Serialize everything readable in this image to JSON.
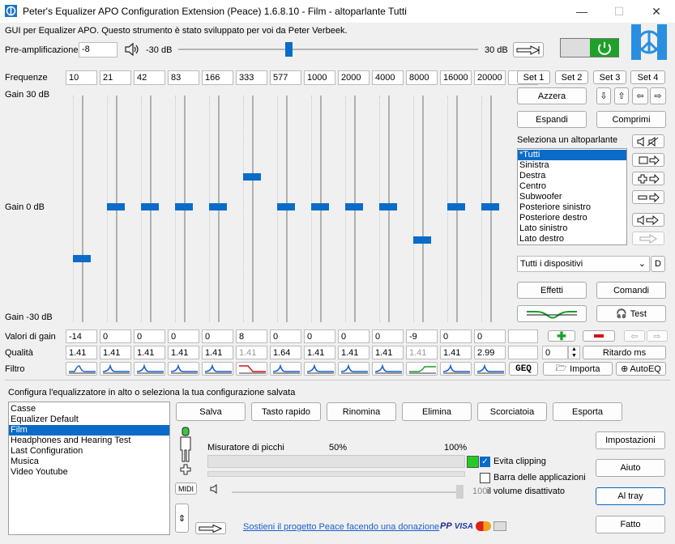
{
  "window": {
    "title": "Peter's Equalizer APO Configuration Extension (Peace) 1.6.8.10 - Film - altoparlante Tutti",
    "minimize": "—",
    "maximize": "☐",
    "close": "✕"
  },
  "header": {
    "description": "GUI per Equalizer APO. Questo strumento è stato sviluppato per voi da Peter Verbeek.",
    "preamp_label": "Pre-amplificazione",
    "preamp_value": "-8",
    "preamp_min": "-30 dB",
    "preamp_max": "30 dB",
    "preamp_level": -8
  },
  "eq": {
    "frequencies_label": "Frequenze",
    "frequencies": [
      "10",
      "21",
      "42",
      "83",
      "166",
      "333",
      "577",
      "1000",
      "2000",
      "4000",
      "8000",
      "16000",
      "20000",
      ""
    ],
    "gain_top": "Gain 30 dB",
    "gain_mid": "Gain 0 dB",
    "gain_bottom": "Gain -30 dB",
    "gain_values_label": "Valori di gain",
    "gains": [
      "-14",
      "0",
      "0",
      "0",
      "0",
      "8",
      "0",
      "0",
      "0",
      "0",
      "-9",
      "0",
      "0",
      ""
    ],
    "gain_numbers": [
      -14,
      0,
      0,
      0,
      0,
      8,
      0,
      0,
      0,
      0,
      -9,
      0,
      0
    ],
    "quality_label": "Qualità",
    "qualities": [
      "1.41",
      "1.41",
      "1.41",
      "1.41",
      "1.41",
      "1.41",
      "1.64",
      "1.41",
      "1.41",
      "1.41",
      "1.41",
      "1.41",
      "2.99",
      ""
    ],
    "quality_disabled": [
      false,
      false,
      false,
      false,
      false,
      true,
      false,
      false,
      false,
      false,
      true,
      false,
      false
    ],
    "filter_label": "Filtro",
    "filters": [
      "low-shelf",
      "peak",
      "peak",
      "peak",
      "peak",
      "high-shelf",
      "peak",
      "peak",
      "peak",
      "peak",
      "step",
      "peak",
      "peak"
    ],
    "geq": "GEQ",
    "import": "Importa",
    "autoeq": "AutoEQ",
    "delay_value": "0",
    "delay_button": "Ritardo ms"
  },
  "right_panel": {
    "sets": [
      "Set 1",
      "Set 2",
      "Set 3",
      "Set 4"
    ],
    "reset": "Azzera",
    "expand": "Espandi",
    "compress": "Comprimi",
    "speaker_label": "Seleziona un altoparlante",
    "speakers": [
      "*Tutti",
      "Sinistra",
      "Destra",
      "Centro",
      "Subwoofer",
      "Posteriore sinistro",
      "Posteriore destro",
      "Lato sinistro",
      "Lato destro"
    ],
    "selected_speaker": 0,
    "device_select": "Tutti i dispositivi",
    "device_d": "D",
    "effects": "Effetti",
    "commands": "Comandi",
    "test": "Test",
    "power_color": "#1fa02a",
    "accent": "#0a6cc8"
  },
  "config": {
    "label": "Configura l'equalizzatore in alto o seleziona la tua configurazione salvata",
    "items": [
      "Casse",
      "Equalizer Default",
      "Film",
      "Headphones and Hearing Test",
      "Last Configuration",
      "Musica",
      "Video Youtube"
    ],
    "selected": 2,
    "buttons": [
      "Salva",
      "Tasto rapido",
      "Rinomina",
      "Elimina",
      "Scorciatoia",
      "Esporta"
    ],
    "midi": "MIDI"
  },
  "meter": {
    "label": "Misuratore di picchi",
    "p50": "50%",
    "p100": "100%",
    "avoid_clipping": "Evita clipping",
    "avoid_clipping_checked": true,
    "app_bar": "Barra delle applicazioni",
    "app_bar_checked": false,
    "volume_value": "100",
    "volume_muted": "il volume disattivato",
    "indicator_color": "#22cc22"
  },
  "footer": {
    "donate": "Sostieni il progetto Peace facendo una donazione",
    "settings": "Impostazioni",
    "help": "Aiuto",
    "tray": "Al tray",
    "done": "Fatto"
  }
}
